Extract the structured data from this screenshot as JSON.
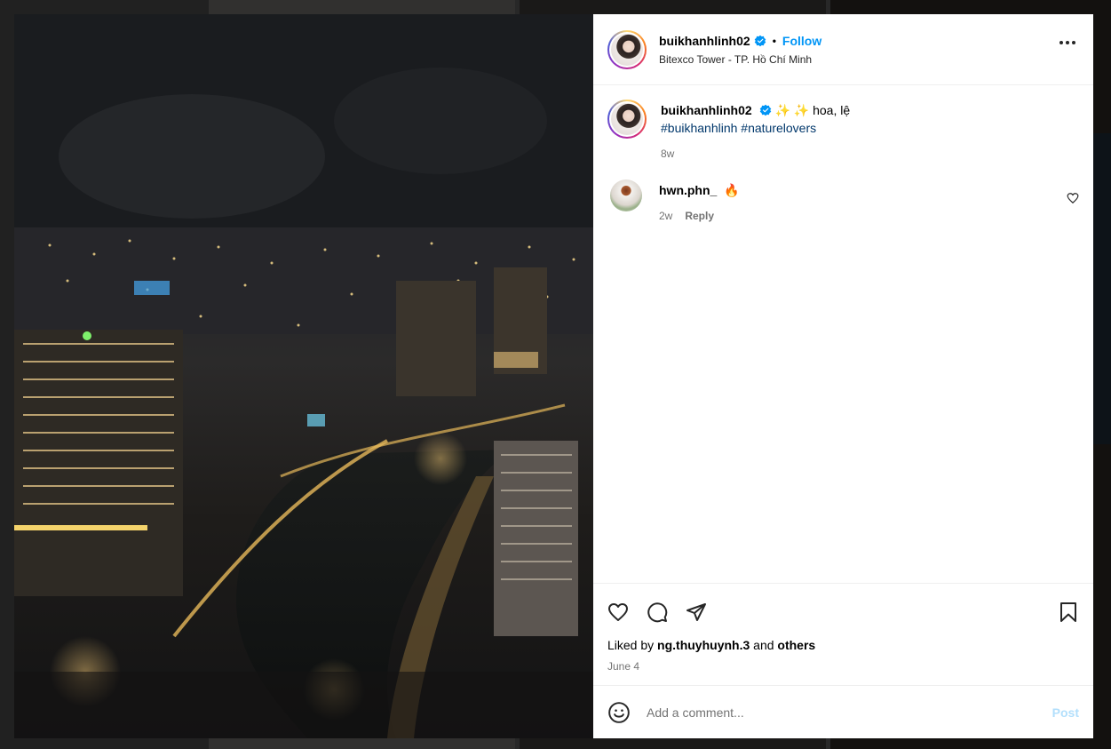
{
  "post": {
    "username": "buikhanhlinh02",
    "separator": "•",
    "follow_label": "Follow",
    "location": "Bitexco Tower - TP. Hồ Chí Minh",
    "caption_text": "✨ ✨  hoa, lệ",
    "hashtags": [
      "#buikhanhlinh",
      "#naturelovers"
    ],
    "caption_age": "8w"
  },
  "comments": [
    {
      "username": "hwn.phn_",
      "text": "🔥",
      "age": "2w",
      "reply_label": "Reply"
    }
  ],
  "engagement": {
    "liked_by_prefix": "Liked by",
    "liked_by_user": "ng.thuyhuynh.3",
    "liked_by_and": "and",
    "liked_by_others": "others",
    "date": "June 4"
  },
  "composer": {
    "placeholder": "Add a comment...",
    "post_label": "Post"
  },
  "icons": {
    "verified": "verified-badge-icon",
    "more": "more-options-icon",
    "like": "heart-icon",
    "comment": "comment-icon",
    "share": "share-icon",
    "save": "bookmark-icon",
    "emoji": "emoji-icon"
  },
  "colors": {
    "accent": "#0095f6",
    "hashtag": "#00376b",
    "muted": "#737373",
    "post_disabled": "#b2dffc"
  }
}
